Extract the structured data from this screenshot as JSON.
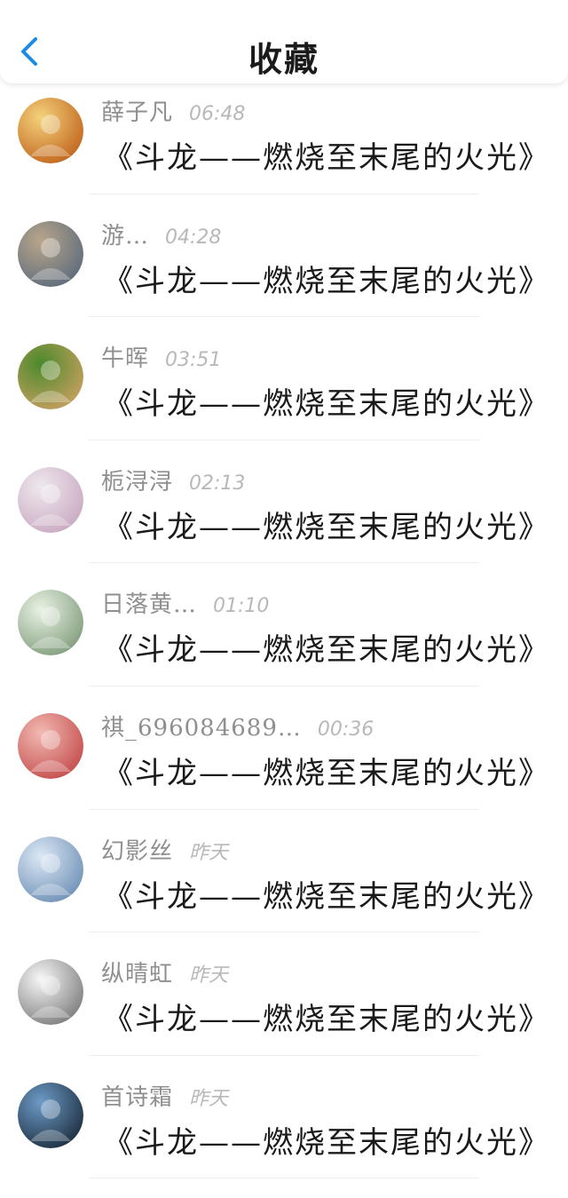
{
  "header": {
    "title": "收藏",
    "back_icon": "chevron-left-icon",
    "accent_color": "#1a8ce6"
  },
  "favorites": [
    {
      "name": "薛子凡",
      "time": "06:48",
      "text": "《斗龙——燃烧至末尾的火光》",
      "avatar_colors": [
        "#f4d27a",
        "#c0621c"
      ]
    },
    {
      "name": "游…",
      "time": "04:28",
      "text": "《斗龙——燃烧至末尾的火光》",
      "avatar_colors": [
        "#b9a58a",
        "#5b6b7c"
      ]
    },
    {
      "name": "牛晖",
      "time": "03:51",
      "text": "《斗龙——燃烧至末尾的火光》",
      "avatar_colors": [
        "#4b8a2c",
        "#c9a060"
      ]
    },
    {
      "name": "栀浔浔",
      "time": "02:13",
      "text": "《斗龙——燃烧至末尾的火光》",
      "avatar_colors": [
        "#eee8ee",
        "#c9a8c0"
      ]
    },
    {
      "name": "日落黄…",
      "time": "01:10",
      "text": "《斗龙——燃烧至末尾的火光》",
      "avatar_colors": [
        "#e9f1e4",
        "#7f9c7a"
      ]
    },
    {
      "name": "祺_696084689…",
      "time": "00:36",
      "text": "《斗龙——燃烧至末尾的火光》",
      "avatar_colors": [
        "#f2b9b2",
        "#c34b4b"
      ]
    },
    {
      "name": "幻影丝",
      "time": "昨天",
      "text": "《斗龙——燃烧至末尾的火光》",
      "avatar_colors": [
        "#dbe8f5",
        "#6d8fb5"
      ]
    },
    {
      "name": "纵晴虹",
      "time": "昨天",
      "text": "《斗龙——燃烧至末尾的火光》",
      "avatar_colors": [
        "#f7f7f7",
        "#7a7a7a"
      ]
    },
    {
      "name": "首诗霜",
      "time": "昨天",
      "text": "《斗龙——燃烧至末尾的火光》",
      "avatar_colors": [
        "#6d9bc8",
        "#1c2c3c"
      ]
    }
  ]
}
